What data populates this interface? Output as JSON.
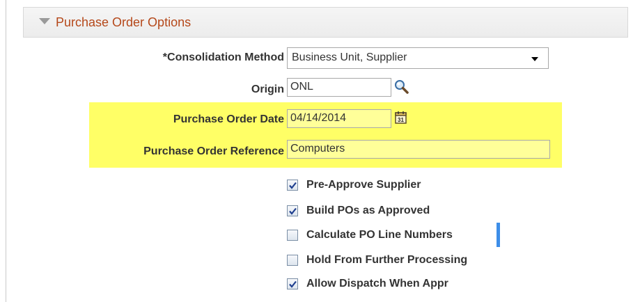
{
  "section": {
    "title": "Purchase Order Options"
  },
  "consolidation": {
    "label": "*Consolidation Method",
    "value": "Business Unit, Supplier"
  },
  "origin": {
    "label": "Origin",
    "value": "ONL"
  },
  "po_date": {
    "label": "Purchase Order Date",
    "value": "04/14/2014",
    "calendar_day": "31"
  },
  "po_reference": {
    "label": "Purchase Order Reference",
    "value": "Computers"
  },
  "checkboxes": [
    {
      "label": "Pre-Approve Supplier",
      "checked": true
    },
    {
      "label": "Build POs as Approved",
      "checked": true
    },
    {
      "label": "Calculate PO Line Numbers",
      "checked": false
    },
    {
      "label": "Hold From Further Processing",
      "checked": false
    },
    {
      "label": "Allow Dispatch When Appr",
      "checked": true
    }
  ],
  "colors": {
    "section_title": "#b5481a",
    "highlight": "#ffff66",
    "focus_bar": "#3d8ee8"
  }
}
